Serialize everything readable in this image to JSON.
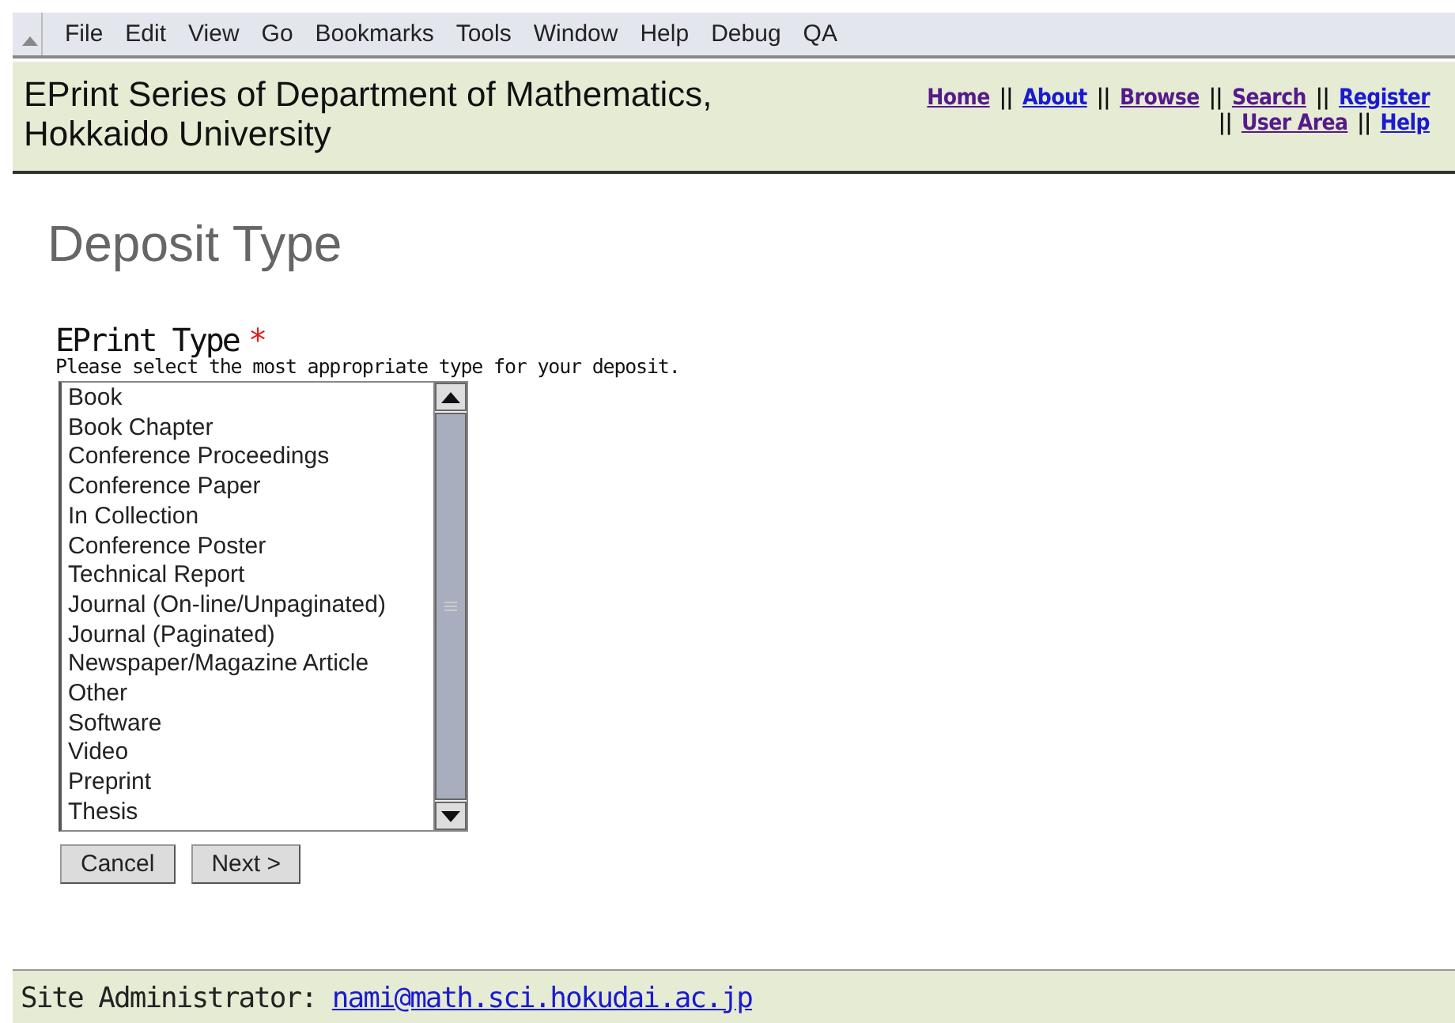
{
  "menu_bar": [
    "File",
    "Edit",
    "View",
    "Go",
    "Bookmarks",
    "Tools",
    "Window",
    "Help",
    "Debug",
    "QA"
  ],
  "header": {
    "title_lines": [
      "EPrint Series of Department of Mathematics,",
      "Hokkaido University"
    ],
    "nav_lines": [
      [
        {
          "kind": "link",
          "label": "Home",
          "visited": true
        },
        {
          "kind": "separator",
          "label": "||"
        },
        {
          "kind": "link",
          "label": "About",
          "visited": false
        },
        {
          "kind": "separator",
          "label": "||"
        },
        {
          "kind": "link",
          "label": "Browse",
          "visited": true
        },
        {
          "kind": "separator",
          "label": "||"
        },
        {
          "kind": "link",
          "label": "Search",
          "visited": true
        },
        {
          "kind": "separator",
          "label": "||"
        },
        {
          "kind": "link",
          "label": "Register",
          "visited": false
        }
      ],
      [
        {
          "kind": "separator",
          "label": "||"
        },
        {
          "kind": "link",
          "label": "User Area",
          "visited": true
        },
        {
          "kind": "separator",
          "label": "||"
        },
        {
          "kind": "link",
          "label": "Help",
          "visited": false
        }
      ]
    ]
  },
  "page_title": "Deposit Type",
  "field": {
    "label": "EPrint Type",
    "required_mark": "*",
    "help": "Please select the most appropriate type for your deposit.",
    "options": [
      {
        "label": "Book",
        "selected": false
      },
      {
        "label": "Book Chapter",
        "selected": false
      },
      {
        "label": "Conference Proceedings",
        "selected": false
      },
      {
        "label": "Conference Paper",
        "selected": false
      },
      {
        "label": "In Collection",
        "selected": false
      },
      {
        "label": "Conference Poster",
        "selected": false
      },
      {
        "label": "Technical Report",
        "selected": false
      },
      {
        "label": "Journal (On-line/Unpaginated)",
        "selected": false
      },
      {
        "label": "Journal (Paginated)",
        "selected": false
      },
      {
        "label": "Newspaper/Magazine Article",
        "selected": false
      },
      {
        "label": "Other",
        "selected": false
      },
      {
        "label": "Software",
        "selected": false
      },
      {
        "label": "Video",
        "selected": false
      },
      {
        "label": "Preprint",
        "selected": false
      },
      {
        "label": "Thesis",
        "selected": false
      }
    ]
  },
  "buttons": [
    "Cancel",
    "Next >"
  ],
  "footer": {
    "label": "Site Administrator:",
    "email": "nami@math.sci.hokudai.ac.jp"
  }
}
